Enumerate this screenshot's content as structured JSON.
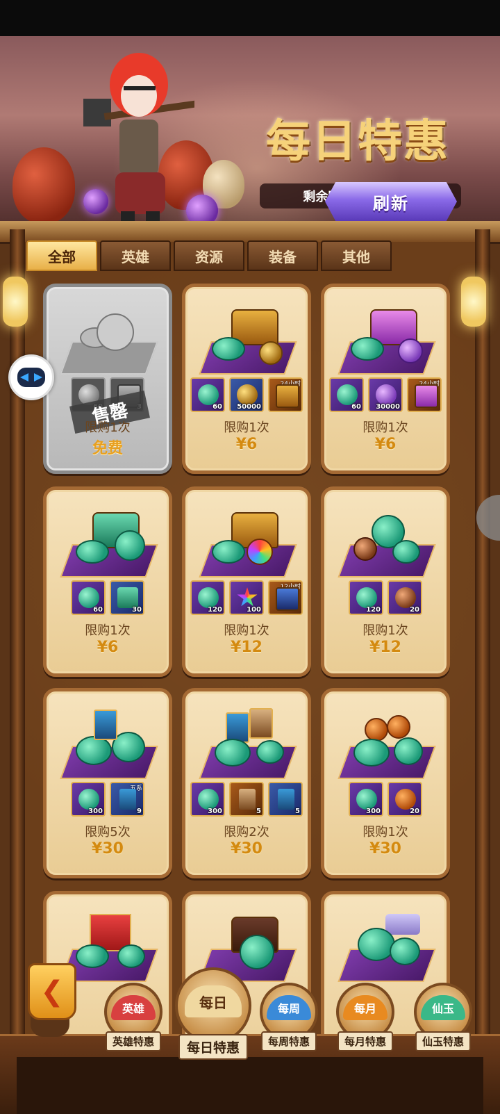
{
  "header": {
    "title_art": "每日特惠",
    "timer": "剩余时间:21时21分",
    "refresh_label": "刷新"
  },
  "tabs": [
    {
      "label": "全部",
      "active": true
    },
    {
      "label": "英雄",
      "active": false
    },
    {
      "label": "资源",
      "active": false
    },
    {
      "label": "装备",
      "active": false
    },
    {
      "label": "其他",
      "active": false
    }
  ],
  "cards": [
    {
      "state": "sold",
      "items": [
        {
          "icon": "jade-coin-icon",
          "count": "60"
        },
        {
          "icon": "item-icon",
          "count": "3"
        }
      ],
      "limit": "限购1次",
      "price": "免费",
      "stamp": "售罄"
    },
    {
      "items": [
        {
          "icon": "jade-coin-icon",
          "count": "60"
        },
        {
          "icon": "gold-coin-icon",
          "count": "50000"
        },
        {
          "icon": "gold-chest-icon",
          "tag": "24小时"
        }
      ],
      "limit": "限购1次",
      "price": "¥6"
    },
    {
      "items": [
        {
          "icon": "jade-coin-icon",
          "count": "60"
        },
        {
          "icon": "purple-essence-icon",
          "count": "30000"
        },
        {
          "icon": "purple-chest-icon",
          "tag": "24小时"
        }
      ],
      "limit": "限购1次",
      "price": "¥6"
    },
    {
      "items": [
        {
          "icon": "jade-coin-icon",
          "count": "60"
        },
        {
          "icon": "jade-chest-icon",
          "count": "30"
        }
      ],
      "limit": "限购1次",
      "price": "¥6"
    },
    {
      "items": [
        {
          "icon": "jade-coin-icon",
          "count": "120"
        },
        {
          "icon": "rainbow-star-icon",
          "count": "100"
        },
        {
          "icon": "treasure-chest-icon",
          "tag": "12小时"
        }
      ],
      "limit": "限购1次",
      "price": "¥12"
    },
    {
      "items": [
        {
          "icon": "jade-coin-icon",
          "count": "120"
        },
        {
          "icon": "bronze-coin-icon",
          "count": "20"
        }
      ],
      "limit": "限购1次",
      "price": "¥12"
    },
    {
      "items": [
        {
          "icon": "jade-coin-icon",
          "count": "300"
        },
        {
          "icon": "hero-card-icon",
          "count": "9",
          "tag": "五系"
        }
      ],
      "limit": "限购5次",
      "price": "¥30"
    },
    {
      "items": [
        {
          "icon": "jade-coin-icon",
          "count": "300"
        },
        {
          "icon": "scroll-card-icon",
          "count": "5"
        },
        {
          "icon": "blue-card-icon",
          "count": "5"
        }
      ],
      "limit": "限购2次",
      "price": "¥30"
    },
    {
      "items": [
        {
          "icon": "jade-coin-icon",
          "count": "300"
        },
        {
          "icon": "orange-coin-icon",
          "count": "20"
        }
      ],
      "limit": "限购1次",
      "price": "¥30"
    }
  ],
  "bottom_nav": [
    {
      "label": "英雄特惠",
      "fan_text": "英雄",
      "color": "#d84040",
      "active": false
    },
    {
      "label": "每日特惠",
      "fan_text": "每日",
      "color": "#f0d8a0",
      "active": true
    },
    {
      "label": "每周特惠",
      "fan_text": "每周",
      "color": "#3a8ad8",
      "active": false
    },
    {
      "label": "每月特惠",
      "fan_text": "每月",
      "color": "#e88a20",
      "active": false
    },
    {
      "label": "仙玉特惠",
      "fan_text": "仙玉",
      "color": "#3ab888",
      "active": false
    }
  ],
  "colors": {
    "accent_gold": "#f6d27a",
    "price": "#d48a10",
    "frame": "#6b3e1a"
  }
}
